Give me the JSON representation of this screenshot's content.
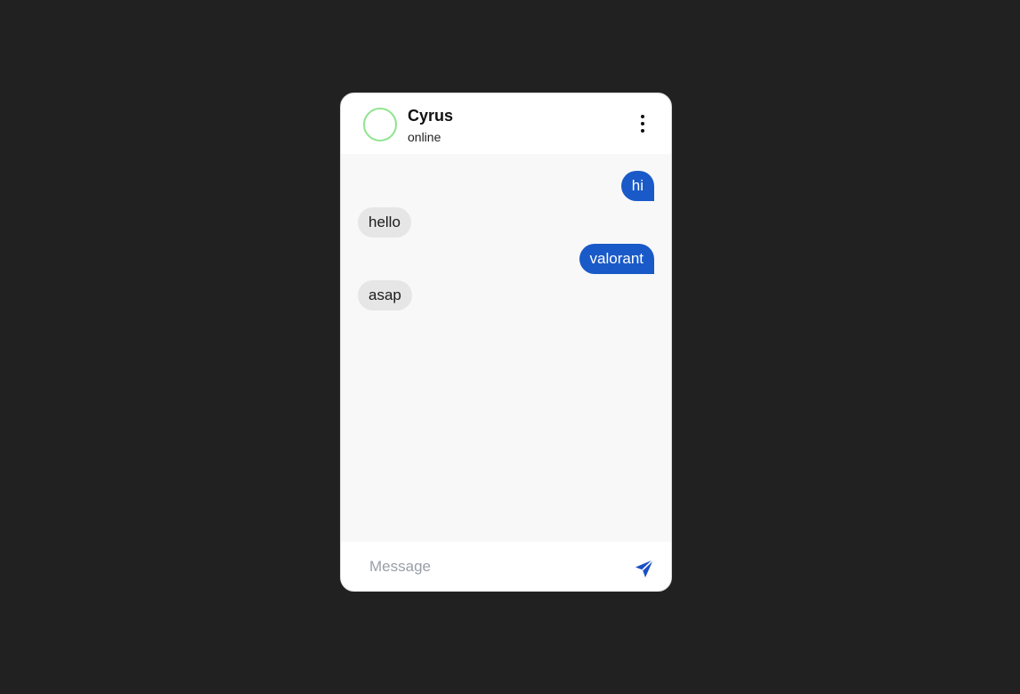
{
  "contact": {
    "name": "Cyrus",
    "status": "online"
  },
  "messages": [
    {
      "direction": "out",
      "text": "hi"
    },
    {
      "direction": "in",
      "text": "hello"
    },
    {
      "direction": "out",
      "text": "valorant"
    },
    {
      "direction": "in",
      "text": "asap"
    }
  ],
  "composer": {
    "placeholder": "Message",
    "value": ""
  },
  "icons": {
    "menu": "more-vertical-icon",
    "send": "send-icon"
  },
  "colors": {
    "background": "#212121",
    "outgoing_bubble": "#1a5ac8",
    "incoming_bubble": "#e6e6e6",
    "avatar_ring": "#8fe48f",
    "accent": "#1a4fc4"
  }
}
